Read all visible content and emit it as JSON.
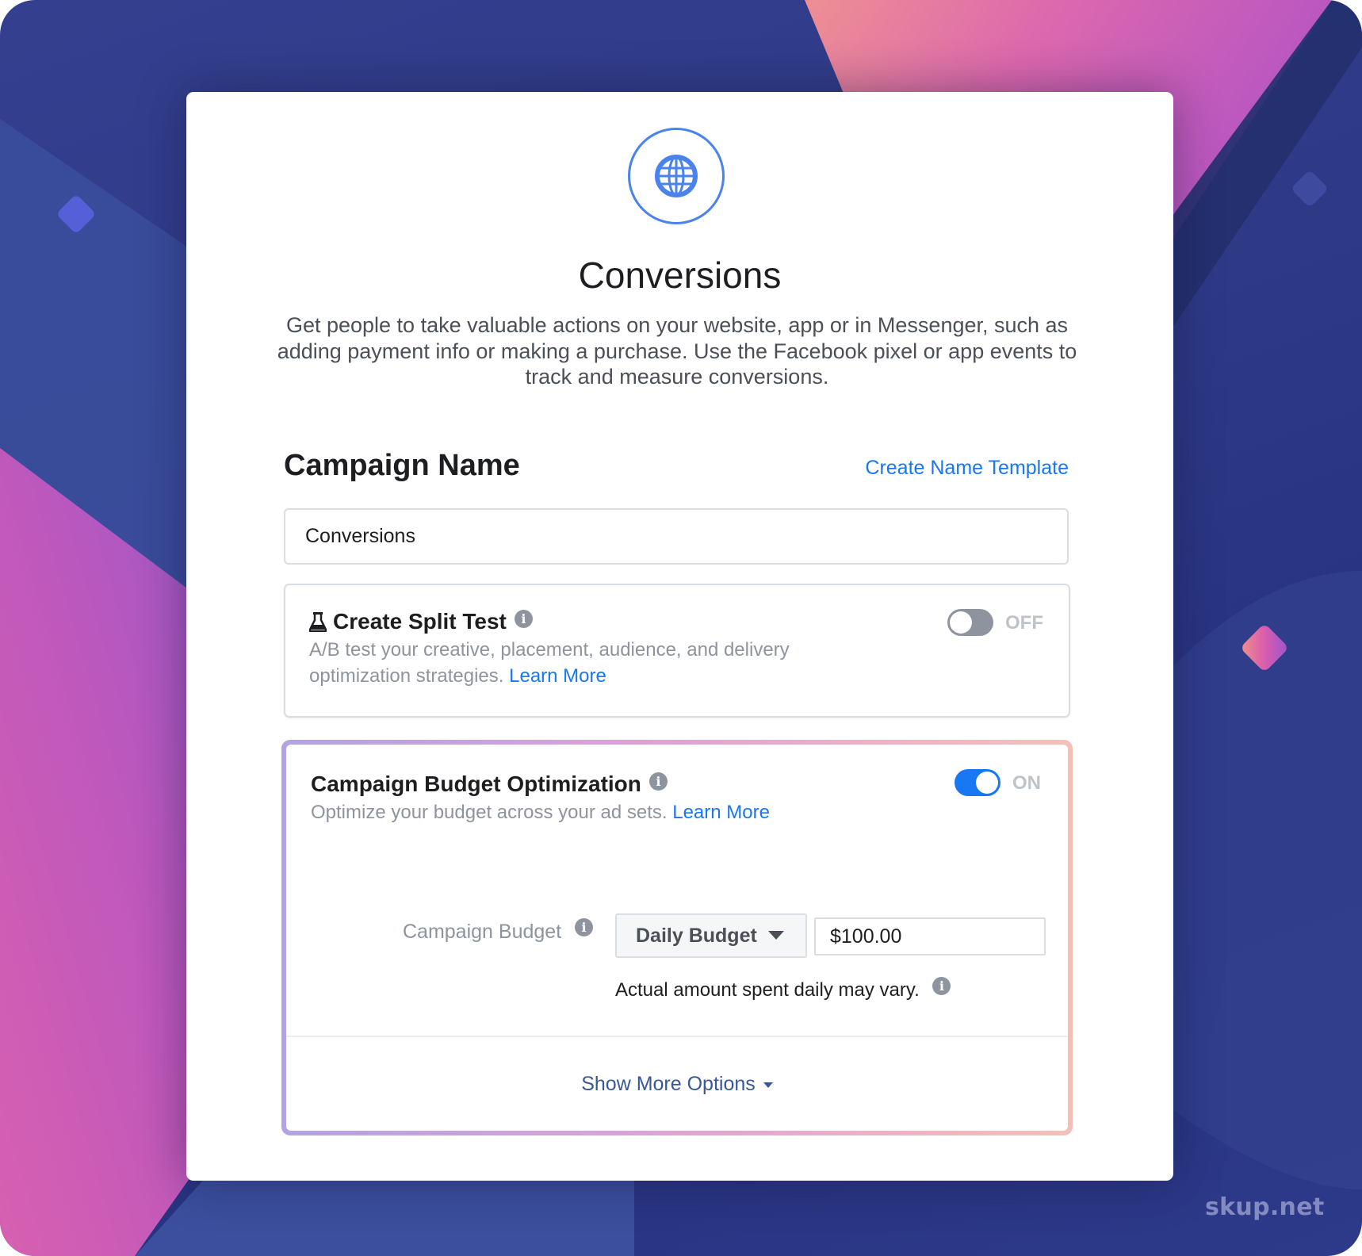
{
  "header": {
    "icon": "globe-icon",
    "title": "Conversions",
    "description": "Get people to take valuable actions on your website, app or in Messenger, such as adding payment info or making a purchase. Use the Facebook pixel or app events to track and measure conversions."
  },
  "campaign_name": {
    "label": "Campaign Name",
    "template_link": "Create Name Template",
    "value": "Conversions"
  },
  "split_test": {
    "icon": "flask-icon",
    "title": "Create Split Test",
    "description": "A/B test your creative, placement, audience, and delivery optimization strategies.",
    "learn_more": "Learn More",
    "toggle_state": "OFF",
    "enabled": false
  },
  "cbo": {
    "title": "Campaign Budget Optimization",
    "description": "Optimize your budget across your ad sets.",
    "learn_more": "Learn More",
    "toggle_state": "ON",
    "enabled": true,
    "budget_label": "Campaign Budget",
    "budget_type": "Daily Budget",
    "budget_amount": "$100.00",
    "budget_note": "Actual amount spent daily may vary.",
    "show_more": "Show More Options"
  },
  "info_icon_glyph": "i",
  "watermark": "skup.net",
  "colors": {
    "accent": "#1877f2",
    "globe": "#4a82ee",
    "toggle_off": "#8d949e",
    "show_more": "#385898"
  }
}
